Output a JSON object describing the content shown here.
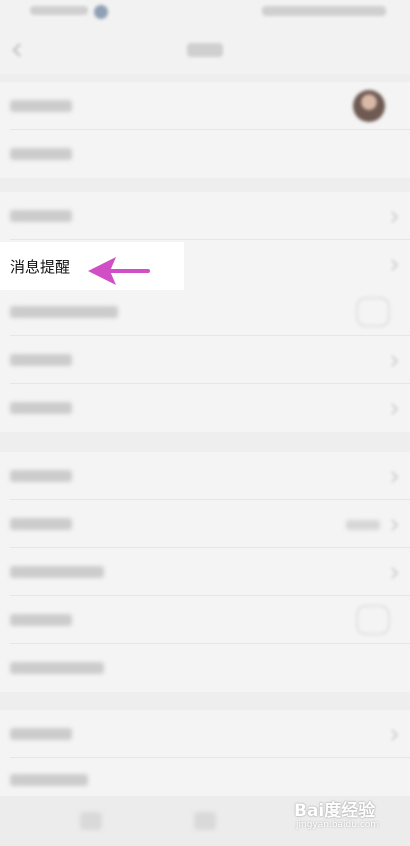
{
  "highlighted_item": {
    "label": "消息提醒"
  },
  "annotation": {
    "arrow_color": "#d14fc4"
  },
  "watermark": {
    "text": "Bai度经验",
    "subtext": "jingyan.baidu.com"
  },
  "colors": {
    "background": "#eeeeee",
    "row_bg": "#f4f4f4",
    "highlight_bg": "#ffffff"
  }
}
